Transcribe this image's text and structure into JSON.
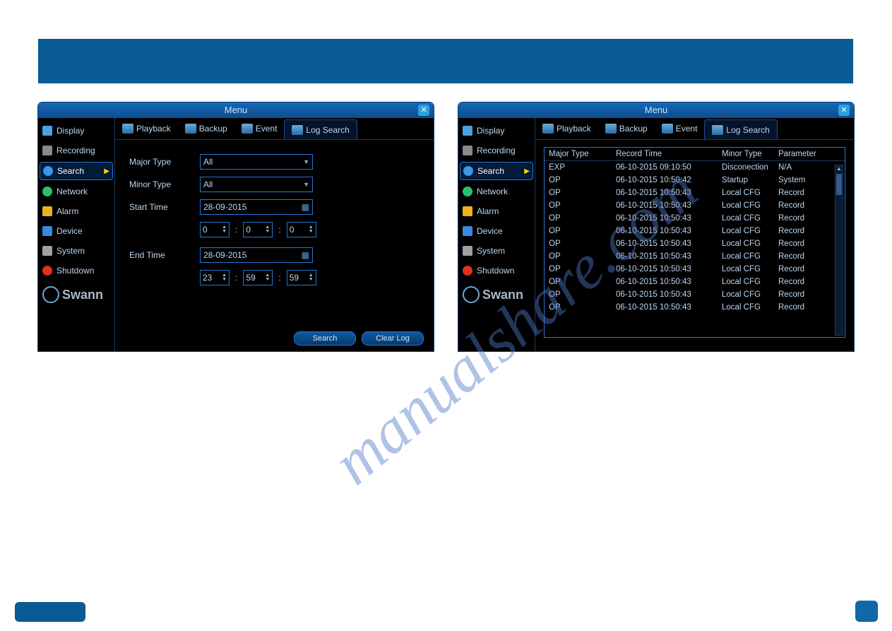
{
  "watermark": "manualshare.com",
  "window": {
    "title": "Menu",
    "close": "✕"
  },
  "sidebar": {
    "items": [
      {
        "label": "Display",
        "icon": "display-icon",
        "color": "#4aa0e0"
      },
      {
        "label": "Recording",
        "icon": "recording-icon",
        "color": "#8a8a8a"
      },
      {
        "label": "Search",
        "icon": "search-icon",
        "color": "#3a96e8",
        "active": true
      },
      {
        "label": "Network",
        "icon": "network-icon",
        "color": "#2ac070"
      },
      {
        "label": "Alarm",
        "icon": "alarm-icon",
        "color": "#f0b020"
      },
      {
        "label": "Device",
        "icon": "device-icon",
        "color": "#3a88e0"
      },
      {
        "label": "System",
        "icon": "system-icon",
        "color": "#a0a0a0"
      },
      {
        "label": "Shutdown",
        "icon": "shutdown-icon",
        "color": "#e03020"
      }
    ],
    "logo": "Swann"
  },
  "tabs": [
    {
      "label": "Playback"
    },
    {
      "label": "Backup"
    },
    {
      "label": "Event"
    },
    {
      "label": "Log Search",
      "active": true
    }
  ],
  "form": {
    "major_type_label": "Major Type",
    "major_type_value": "All",
    "minor_type_label": "Minor Type",
    "minor_type_value": "All",
    "start_time_label": "Start Time",
    "start_date": "28-09-2015",
    "start_h": "0",
    "start_m": "0",
    "start_s": "0",
    "end_time_label": "End Time",
    "end_date": "28-09-2015",
    "end_h": "23",
    "end_m": "59",
    "end_s": "59"
  },
  "buttons": {
    "search": "Search",
    "clear": "Clear Log"
  },
  "table": {
    "headers": {
      "c1": "Major Type",
      "c2": "Record Time",
      "c3": "Minor Type",
      "c4": "Parameter"
    },
    "rows": [
      {
        "c1": "EXP",
        "c2": "06-10-2015 09:10:50",
        "c3": "Disconection",
        "c4": "N/A"
      },
      {
        "c1": "OP",
        "c2": "06-10-2015 10:50:42",
        "c3": "Startup",
        "c4": "System"
      },
      {
        "c1": "OP",
        "c2": "06-10-2015 10:50:43",
        "c3": "Local CFG",
        "c4": "Record"
      },
      {
        "c1": "OP",
        "c2": "06-10-2015 10:50:43",
        "c3": "Local CFG",
        "c4": "Record"
      },
      {
        "c1": "OP",
        "c2": "06-10-2015 10:50:43",
        "c3": "Local CFG",
        "c4": "Record"
      },
      {
        "c1": "OP",
        "c2": "06-10-2015 10:50:43",
        "c3": "Local CFG",
        "c4": "Record"
      },
      {
        "c1": "OP",
        "c2": "06-10-2015 10:50:43",
        "c3": "Local CFG",
        "c4": "Record"
      },
      {
        "c1": "OP",
        "c2": "06-10-2015 10:50:43",
        "c3": "Local CFG",
        "c4": "Record"
      },
      {
        "c1": "OP",
        "c2": "06-10-2015 10:50:43",
        "c3": "Local CFG",
        "c4": "Record"
      },
      {
        "c1": "OP",
        "c2": "06-10-2015 10:50:43",
        "c3": "Local CFG",
        "c4": "Record"
      },
      {
        "c1": "OP",
        "c2": "06-10-2015 10:50:43",
        "c3": "Local CFG",
        "c4": "Record"
      },
      {
        "c1": "OP",
        "c2": "06-10-2015 10:50:43",
        "c3": "Local CFG",
        "c4": "Record"
      }
    ]
  }
}
